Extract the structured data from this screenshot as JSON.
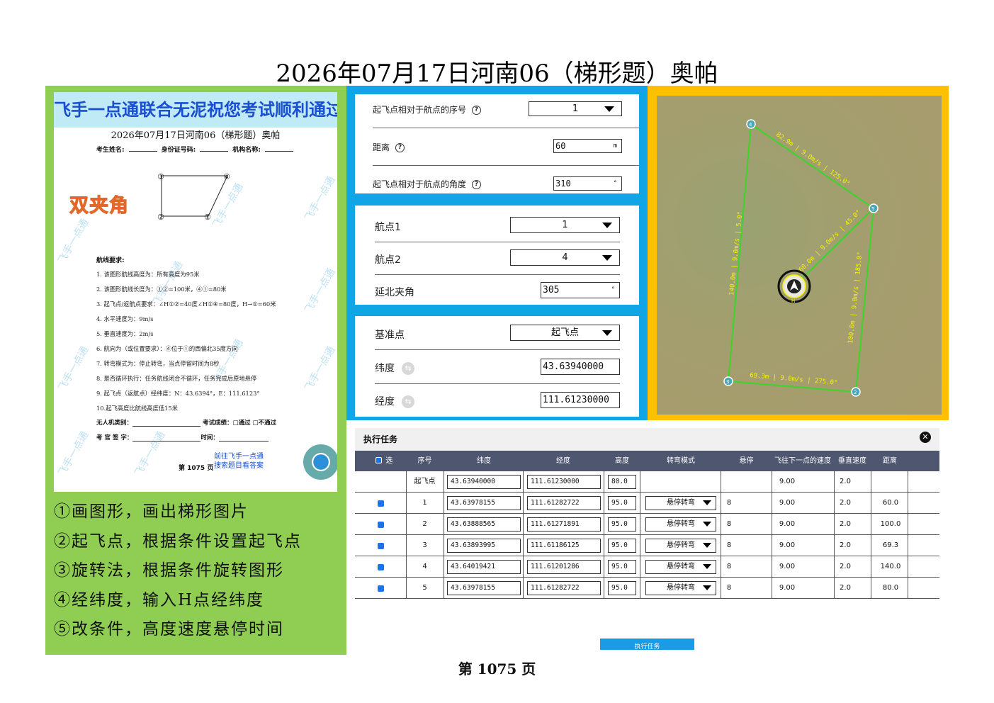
{
  "title": "2026年07月17日河南06（梯形题）奥帕",
  "sheet": {
    "banner": "飞手一点通联合无泥祝您考试顺利通过",
    "title": "2026年07月17日河南06（梯形题）奥帕",
    "fields": [
      "考生姓名:",
      "身份证号码:",
      "机构名称:"
    ],
    "double_angle": "双夹角",
    "points": [
      "④",
      "③",
      "②",
      "①"
    ],
    "req_head": "航线要求:",
    "requirements": [
      "1. 该图形航线高度为：所有高度为95米",
      "2. 该图形航线长度为：①②=100米，④①=80米",
      "3. 起飞点/返航点要求：∠H①②=40度∠H①④=80度，H→①=60米",
      "4. 水平速度为：9m/s",
      "5. 垂直速度为：2m/s",
      "6. 航向为（或位置要求）：④位于①的西偏北35度方向",
      "7. 转弯模式为：停止转弯，当点停留时间为8秒",
      "8. 是否循环执行：任务航线闭合不循环，任务完成后原地悬停",
      "9. 起飞点（返航点）经纬度：N：43.6394°，E：111.6123°",
      "10.起飞高度比航线高度低15米"
    ],
    "uav_type": "无人机类别：",
    "result": "考试成绩：",
    "pass": "□通过",
    "fail": "□不通过",
    "examiner": "考 官 签 字：",
    "time": "时间：",
    "promo1": "前往飞手一点通",
    "promo2": "搜索题目看答案",
    "page": "第 1075 页",
    "watermark": "飞手一点通"
  },
  "steps": [
    "①画图形，画出梯形图片",
    "②起飞点，根据条件设置起飞点",
    "③旋转法，根据条件旋转图形",
    "④经纬度，输入H点经纬度",
    "⑤改条件，高度速度悬停时间"
  ],
  "settings": {
    "seq_label": "起飞点相对于航点的序号",
    "seq_value": "1",
    "distance_label": "距离",
    "distance_value": "60",
    "distance_unit": "m",
    "angle_label": "起飞点相对于航点的角度",
    "angle_value": "310",
    "angle_unit": "°",
    "wp1_label": "航点1",
    "wp1_value": "1",
    "wp2_label": "航点2",
    "wp2_value": "4",
    "north_label": "延北夹角",
    "north_value": "305",
    "north_unit": "°",
    "base_label": "基准点",
    "base_value": "起飞点",
    "lat_label": "纬度",
    "lat_value": "43.63940000",
    "lon_label": "经度",
    "lon_value": "111.61230000",
    "help_glyph": "?",
    "swap_glyph": "⇆"
  },
  "map": {
    "labels": {
      "top": "82.9m | 9.0m/s | 125.0°",
      "left": "140.0m | 9.0m/s | 5.0°",
      "right": "100.0m | 9.0m/s | 185.0°",
      "bottom": "69.3m | 9.0m/s | 275.0°",
      "inner": "60.0m | 9.0m/s | 45.0°"
    },
    "home_label": "H",
    "markers": [
      "4",
      "5",
      "3",
      "2"
    ]
  },
  "task": {
    "title": "执行任务",
    "close": "✕",
    "columns": [
      "选择",
      "序号",
      "纬度",
      "经度",
      "高度",
      "转弯模式",
      "悬停",
      "飞往下一点的速度",
      "垂直速度",
      "距离"
    ],
    "rows": [
      {
        "sel": false,
        "seq": "起飞点",
        "lat": "43.63940000",
        "lon": "111.61230000",
        "alt": "80.0",
        "turn": "",
        "hover": "",
        "speed": "9.00",
        "vspeed": "2.0",
        "dist": ""
      },
      {
        "sel": true,
        "seq": "1",
        "lat": "43.63978155",
        "lon": "111.61282722",
        "alt": "95.0",
        "turn": "悬停转弯",
        "hover": "8",
        "speed": "9.00",
        "vspeed": "2.0",
        "dist": "60.0"
      },
      {
        "sel": true,
        "seq": "2",
        "lat": "43.63888565",
        "lon": "111.61271891",
        "alt": "95.0",
        "turn": "悬停转弯",
        "hover": "8",
        "speed": "9.00",
        "vspeed": "2.0",
        "dist": "100.0"
      },
      {
        "sel": true,
        "seq": "3",
        "lat": "43.63893995",
        "lon": "111.61186125",
        "alt": "95.0",
        "turn": "悬停转弯",
        "hover": "8",
        "speed": "9.00",
        "vspeed": "2.0",
        "dist": "69.3"
      },
      {
        "sel": true,
        "seq": "4",
        "lat": "43.64019421",
        "lon": "111.61201286",
        "alt": "95.0",
        "turn": "悬停转弯",
        "hover": "8",
        "speed": "9.00",
        "vspeed": "2.0",
        "dist": "140.0"
      },
      {
        "sel": true,
        "seq": "5",
        "lat": "43.63978155",
        "lon": "111.61282722",
        "alt": "95.0",
        "turn": "悬停转弯",
        "hover": "8",
        "speed": "9.00",
        "vspeed": "2.0",
        "dist": "80.0"
      }
    ],
    "exec_button": "执行任务"
  },
  "footer": "第 1075 页",
  "colors": {
    "green": "#8fce52",
    "blue": "#12a5e6",
    "yellow": "#ffc000",
    "table_header": "#4e5670",
    "route": "#3ad62a"
  }
}
